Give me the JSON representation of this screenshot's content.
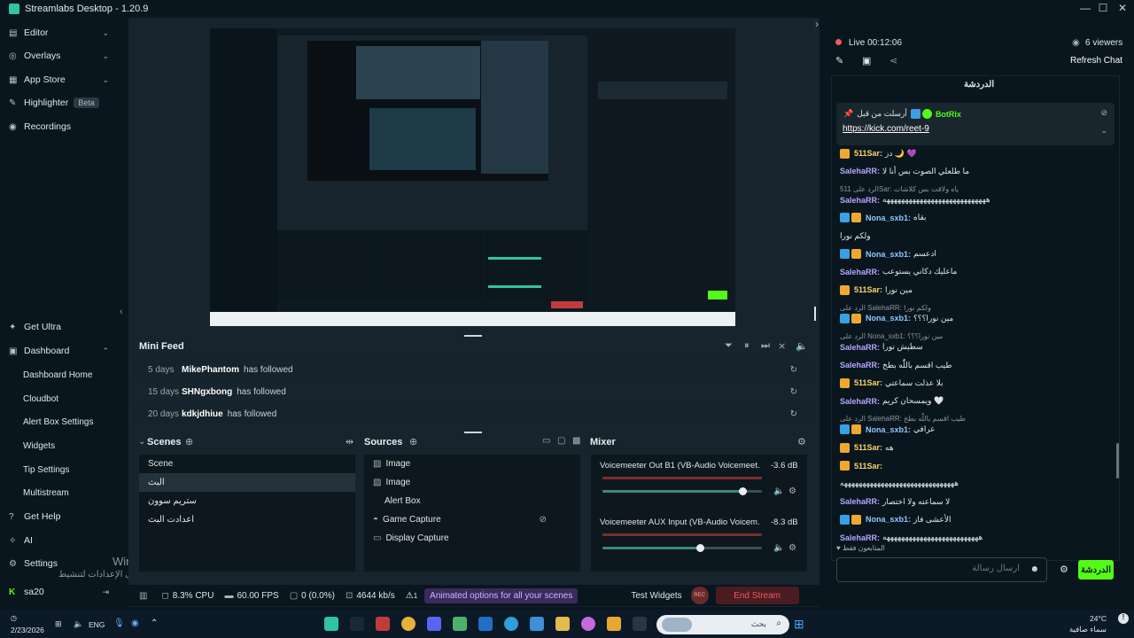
{
  "window": {
    "title": "Streamlabs Desktop - 1.20.9"
  },
  "sidebar": {
    "top_items": [
      {
        "label": "Editor"
      },
      {
        "label": "Overlays"
      },
      {
        "label": "App Store"
      },
      {
        "label": "Highlighter",
        "badge": "Beta"
      },
      {
        "label": "Recordings"
      }
    ],
    "get_ultra": "Get Ultra",
    "dashboard": "Dashboard",
    "dashboard_items": [
      "Dashboard Home",
      "Cloudbot",
      "Alert Box Settings",
      "Widgets",
      "Tip Settings",
      "Multistream"
    ],
    "get_help": "Get Help",
    "ai": "AI",
    "settings": "Settings",
    "user": "sa20",
    "watermark_line1": "Windows تنشيط",
    "watermark_line2": "انتقل إلى الإعدادات لتنشيط Windows."
  },
  "minifeed": {
    "title": "Mini Feed",
    "rows": [
      {
        "days": "5 days",
        "user": "MikePhantom",
        "action": "has followed"
      },
      {
        "days": "15 days",
        "user": "SHNgxbong",
        "action": "has followed"
      },
      {
        "days": "20 days",
        "user": "kdkjdhiue",
        "action": "has followed"
      }
    ]
  },
  "scenes": {
    "title": "Scenes",
    "items": [
      "Scene",
      "البث",
      "ستريم سوون",
      "اعدادت البث"
    ],
    "selected": 1
  },
  "sources": {
    "title": "Sources",
    "items": [
      {
        "label": "Image",
        "icon": "image-icon"
      },
      {
        "label": "Image",
        "icon": "image-icon"
      },
      {
        "label": "Alert Box",
        "icon": "alert-icon"
      },
      {
        "label": "Game Capture",
        "icon": "gamepad-icon"
      },
      {
        "label": "Display Capture",
        "icon": "monitor-icon"
      }
    ]
  },
  "mixer": {
    "title": "Mixer",
    "channels": [
      {
        "name": "Voicemeeter Out B1 (VB-Audio Voicemeet...",
        "db": "-3.6 dB",
        "level": 0.88
      },
      {
        "name": "Voicemeeter AUX Input (VB-Audio Voicem...",
        "db": "-8.3 dB",
        "level": 0.61
      }
    ]
  },
  "status": {
    "cpu": "8.3% CPU",
    "fps": "60.00 FPS",
    "dropped": "0 (0.0%)",
    "bitrate": "4644 kb/s",
    "alert_count": "1",
    "promo": "Animated options for all your scenes",
    "test_widgets": "Test Widgets",
    "rec": "REC",
    "end_stream": "End Stream"
  },
  "chat": {
    "live_label": "Live 00:12:06",
    "viewers": "6 viewers",
    "refresh": "Refresh Chat",
    "header": "الدردشة",
    "pinned_by": "أرسلت من قبل",
    "pinned_user": "BotRix",
    "pinned_link": "https://kick.com/reet-9",
    "messages": [
      {
        "type": "c",
        "user": "511Sar:",
        "text": "دز 🌙 💜"
      },
      {
        "type": "p",
        "user": "SalehaRR:",
        "text": "ما طلعلي الصوت بس أنا لا"
      },
      {
        "type": "r",
        "text": "الرد على 511Sar: ياه ولاقت بس كلاشات"
      },
      {
        "type": "p",
        "user": "SalehaRR:",
        "text": "ههههههههههههههههههههههههههههه"
      },
      {
        "type": "k",
        "user": "Nona_sxb1:",
        "text": "بقاه"
      },
      {
        "type": "x",
        "text": "ولكم نورا"
      },
      {
        "type": "k",
        "user": "Nona_sxb1:",
        "text": "ادعسم"
      },
      {
        "type": "p",
        "user": "SalehaRR:",
        "text": "ماعليك دكاني يستوعب"
      },
      {
        "type": "c",
        "user": "511Sar:",
        "text": "مين نورا"
      },
      {
        "type": "r",
        "text": "الرد على SalehaRR: ولكم نورا"
      },
      {
        "type": "k",
        "user": "Nona_sxb1:",
        "text": "مين نورا؟؟؟"
      },
      {
        "type": "r",
        "text": "الرد على Nona_sxb1: مين نورا؟؟؟"
      },
      {
        "type": "p",
        "user": "SalehaRR:",
        "text": "سطيش نورا"
      },
      {
        "type": "p",
        "user": "SalehaRR:",
        "text": "طيب اقسم باللّٰه بطخ"
      },
      {
        "type": "c",
        "user": "511Sar:",
        "text": "بلا عذلت سماعتي"
      },
      {
        "type": "p",
        "user": "SalehaRR:",
        "text": "ويمسحان كريم 🤍"
      },
      {
        "type": "r",
        "text": "الرد على SalehaRR: طيب اقسم باللّٰه بطخ"
      },
      {
        "type": "k",
        "user": "Nona_sxb1:",
        "text": "عرافي"
      },
      {
        "type": "c",
        "user": "511Sar:",
        "text": "هه"
      },
      {
        "type": "c",
        "user": "511Sar:",
        "text": ""
      },
      {
        "type": "x",
        "text": "هههههههههههههههههههههههههههههههه"
      },
      {
        "type": "p",
        "user": "SalehaRR:",
        "text": "لا سماعته ولا اختصار"
      },
      {
        "type": "k",
        "user": "Nona_sxb1:",
        "text": "الأعشى فاز"
      },
      {
        "type": "p",
        "user": "SalehaRR:",
        "text": "ههههههههههههههههههههههههههه"
      }
    ],
    "followers_only": "المتابعون فقط",
    "input_placeholder": "ارسال رسالة",
    "send_label": "الدردشة"
  },
  "taskbar": {
    "date": "2/23/2026",
    "lang": "ENG",
    "search_placeholder": "بحث",
    "temp": "24°C",
    "weather": "سماء صافية"
  },
  "colors": {
    "accent": "#31c3a2",
    "send": "#53fc18",
    "end_stream": "#f05a5a"
  }
}
